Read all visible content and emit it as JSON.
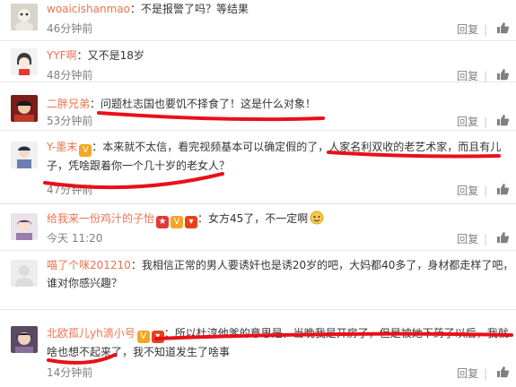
{
  "actions": {
    "reply": "回复"
  },
  "comments": [
    {
      "user": "woaicishanmao",
      "text": "：不是报警了吗？等结果",
      "time": "46分钟前"
    },
    {
      "user": "YYF啊",
      "text": "：又不是18岁",
      "time": "48分钟前"
    },
    {
      "user": "二胖兄弟",
      "text": "：问题杜志国也要饥不择食了！这是什么对象！",
      "time": "53分钟前"
    },
    {
      "user": "Y-墨末",
      "text1": "：本来就不太信，看完视频基本可以确定假的了，人家名利双收的老艺术家，而且有儿",
      "text2": "子，凭啥跟着你一个几十岁的老女人？",
      "time": "47分钟前"
    },
    {
      "user": "给我来一份鸡汁的子怡",
      "text": "：女方45了，不一定啊",
      "time": "今天 11:20"
    },
    {
      "user": "喵了个咪201210",
      "text1": "：我相信正常的男人要诱奸也是诱20岁的吧，大妈都40多了，身材都走样了吧，",
      "text2": "谁对你感兴趣？",
      "time": ""
    },
    {
      "user": "北欧孤儿yh滴小号",
      "text1": "：所以杜淳他爹的意思是，当晚我是开房了，但是被她下药了以后，我就",
      "text2": "啥也想不起来了，我不知道发生了啥事",
      "time": "14分钟前"
    }
  ],
  "colors": {
    "username": "#eb7350",
    "underline": "#e8101a",
    "meta": "#808080"
  }
}
